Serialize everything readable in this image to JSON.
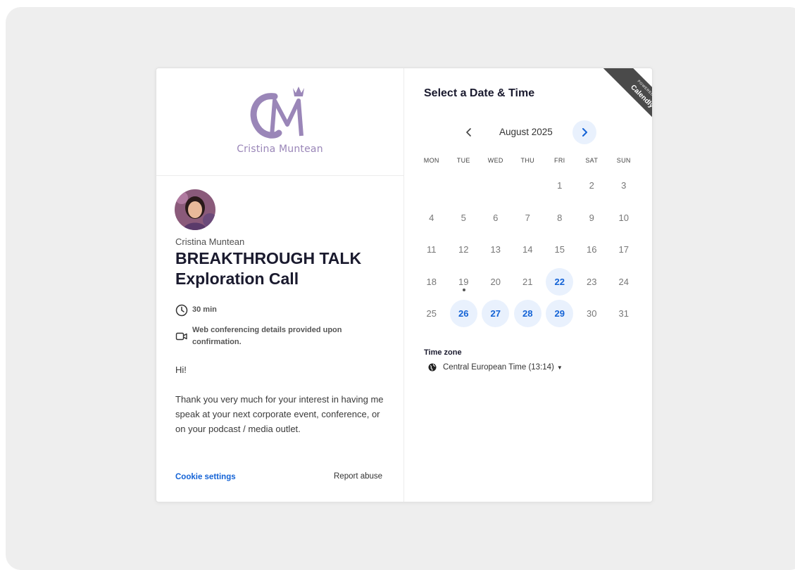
{
  "colors": {
    "accent": "#1463d6",
    "available_bg": "#e9f1fd",
    "logo": "#9a86b8",
    "ribbon": "#4a4a4a"
  },
  "logo": {
    "monogram": "CM",
    "name": "Cristina Muntean"
  },
  "event": {
    "host": "Cristina Muntean",
    "title": "BREAKTHROUGH TALK Exploration Call",
    "duration": "30 min",
    "location": "Web conferencing details provided upon confirmation.",
    "greeting": "Hi!",
    "description": "Thank you very much for your interest in having me speak at your next corporate event, conference, or on your podcast / media outlet."
  },
  "footer": {
    "cookie": "Cookie settings",
    "report": "Report abuse"
  },
  "ribbon": {
    "small": "POWERED BY",
    "big": "Calendly"
  },
  "calendar": {
    "heading": "Select a Date & Time",
    "month": "August 2025",
    "prev_icon": "chevron-left-icon",
    "next_icon": "chevron-right-icon",
    "weekdays": [
      "MON",
      "TUE",
      "WED",
      "THU",
      "FRI",
      "SAT",
      "SUN"
    ],
    "leading_blanks": 4,
    "days_in_month": 31,
    "available_days": [
      22,
      26,
      27,
      28,
      29
    ],
    "today": 19
  },
  "timezone": {
    "label": "Time zone",
    "value": "Central European Time (13:14)",
    "icon": "globe-icon"
  }
}
